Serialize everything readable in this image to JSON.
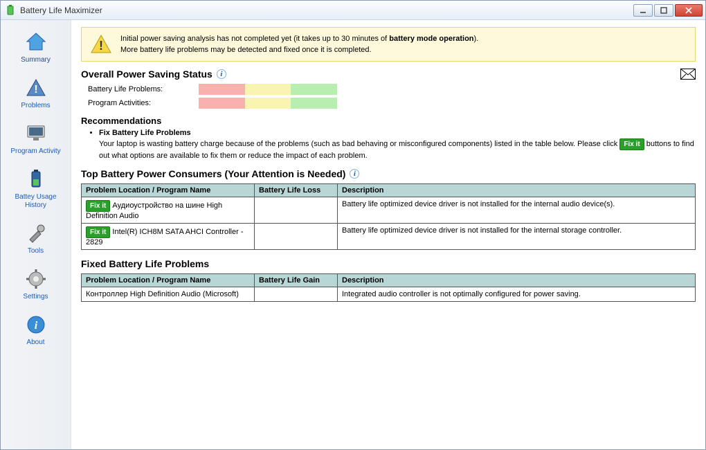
{
  "title": "Battery Life Maximizer",
  "sidebar": {
    "items": [
      {
        "label": "Summary"
      },
      {
        "label": "Problems"
      },
      {
        "label": "Program Activity"
      },
      {
        "label": "Battey Usage History"
      },
      {
        "label": "Tools"
      },
      {
        "label": "Settings"
      },
      {
        "label": "About"
      }
    ]
  },
  "notice": {
    "line1_a": "Initial power saving analysis has not completed yet (it takes up to 30 minutes of ",
    "line1_b": "battery mode operation",
    "line1_c": ").",
    "line2": "More battery life problems may be detected and fixed once it is completed."
  },
  "status": {
    "heading": "Overall Power Saving Status",
    "row1": "Battery Life Problems:",
    "row2": "Program Activities:"
  },
  "recommendations": {
    "heading": "Recommendations",
    "item_title": "Fix Battery Life Problems",
    "item_text_a": "Your laptop is wasting battery charge because of the problems (such as bad behaving or misconfigured components) listed in the table below. Please click ",
    "fixit_label": "Fix it",
    "item_text_b": " buttons to find out what options are available to fix them or reduce the impact of each problem."
  },
  "top_consumers": {
    "heading": "Top Battery Power Consumers (Your Attention is Needed)",
    "cols": {
      "loc": "Problem Location / Program Name",
      "loss": "Battery Life Loss",
      "desc": "Description"
    },
    "rows": [
      {
        "fixit": "Fix it",
        "name": "Аудиоустройство на шине High Definition Audio",
        "loss": "",
        "desc": "Battery life optimized device driver is not installed for the internal audio device(s)."
      },
      {
        "fixit": "Fix it",
        "name": "Intel(R) ICH8M SATA AHCI Controller - 2829",
        "loss": "",
        "desc": "Battery life optimized device driver is not installed for the internal storage controller."
      }
    ]
  },
  "fixed": {
    "heading": "Fixed Battery Life Problems",
    "cols": {
      "loc": "Problem Location / Program Name",
      "gain": "Battery Life Gain",
      "desc": "Description"
    },
    "rows": [
      {
        "name": "Контроллер High Definition Audio (Microsoft)",
        "gain": "",
        "desc": "Integrated audio controller is not optimally configured for power saving."
      }
    ]
  }
}
